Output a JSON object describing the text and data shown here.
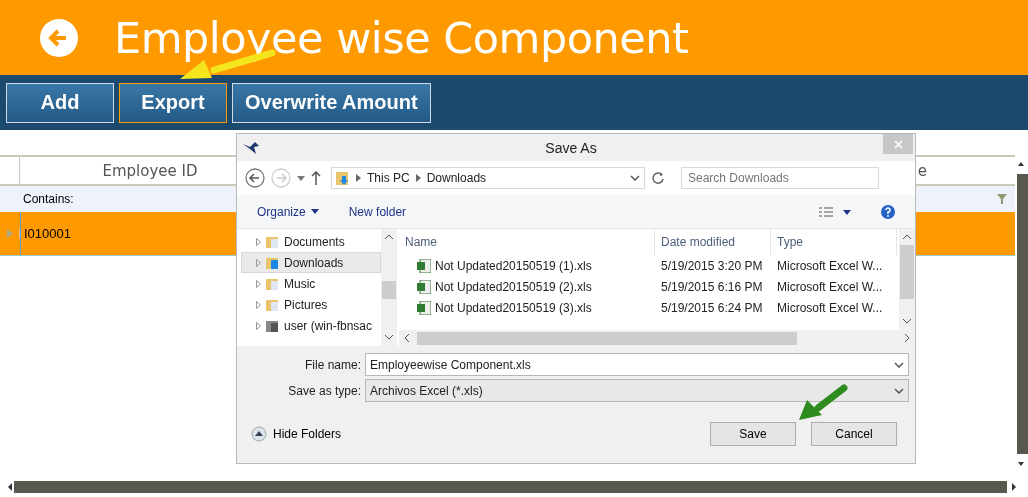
{
  "header": {
    "title": "Employee wise Component"
  },
  "toolbar": {
    "buttons": [
      {
        "label": "Add",
        "selected": false
      },
      {
        "label": "Export",
        "selected": true
      },
      {
        "label": "Overwrite Amount",
        "selected": false
      }
    ]
  },
  "grid": {
    "columns": [
      "Employee ID",
      "e"
    ],
    "filter_label": "Contains:",
    "rows": [
      {
        "employee_id": "I010001",
        "selected": true
      }
    ]
  },
  "dialog": {
    "title": "Save As",
    "crumbs": [
      "This PC",
      "Downloads"
    ],
    "search_placeholder": "Search Downloads",
    "commands": [
      "Organize",
      "New folder"
    ],
    "nav_items": [
      {
        "label": "Documents",
        "kind": "docs",
        "selected": false
      },
      {
        "label": "Downloads",
        "kind": "download",
        "selected": true
      },
      {
        "label": "Music",
        "kind": "music",
        "selected": false
      },
      {
        "label": "Pictures",
        "kind": "pictures",
        "selected": false
      },
      {
        "label": "user (win-fbnsac",
        "kind": "network",
        "selected": false
      }
    ],
    "columns": [
      "Name",
      "Date modified",
      "Type"
    ],
    "files": [
      {
        "name": "Not Updated20150519 (1).xls",
        "date": "5/19/2015 3:20 PM",
        "type": "Microsoft Excel W..."
      },
      {
        "name": "Not Updated20150519 (2).xls",
        "date": "5/19/2015 6:16 PM",
        "type": "Microsoft Excel W..."
      },
      {
        "name": "Not Updated20150519 (3).xls",
        "date": "5/19/2015 6:24 PM",
        "type": "Microsoft Excel W..."
      }
    ],
    "file_name_label": "File name:",
    "file_name": "Employeewise Component.xls",
    "type_label": "Save as type:",
    "type_value": "Archivos Excel (*.xls)",
    "hide_folders": "Hide Folders",
    "buttons": [
      "Save",
      "Cancel"
    ]
  }
}
